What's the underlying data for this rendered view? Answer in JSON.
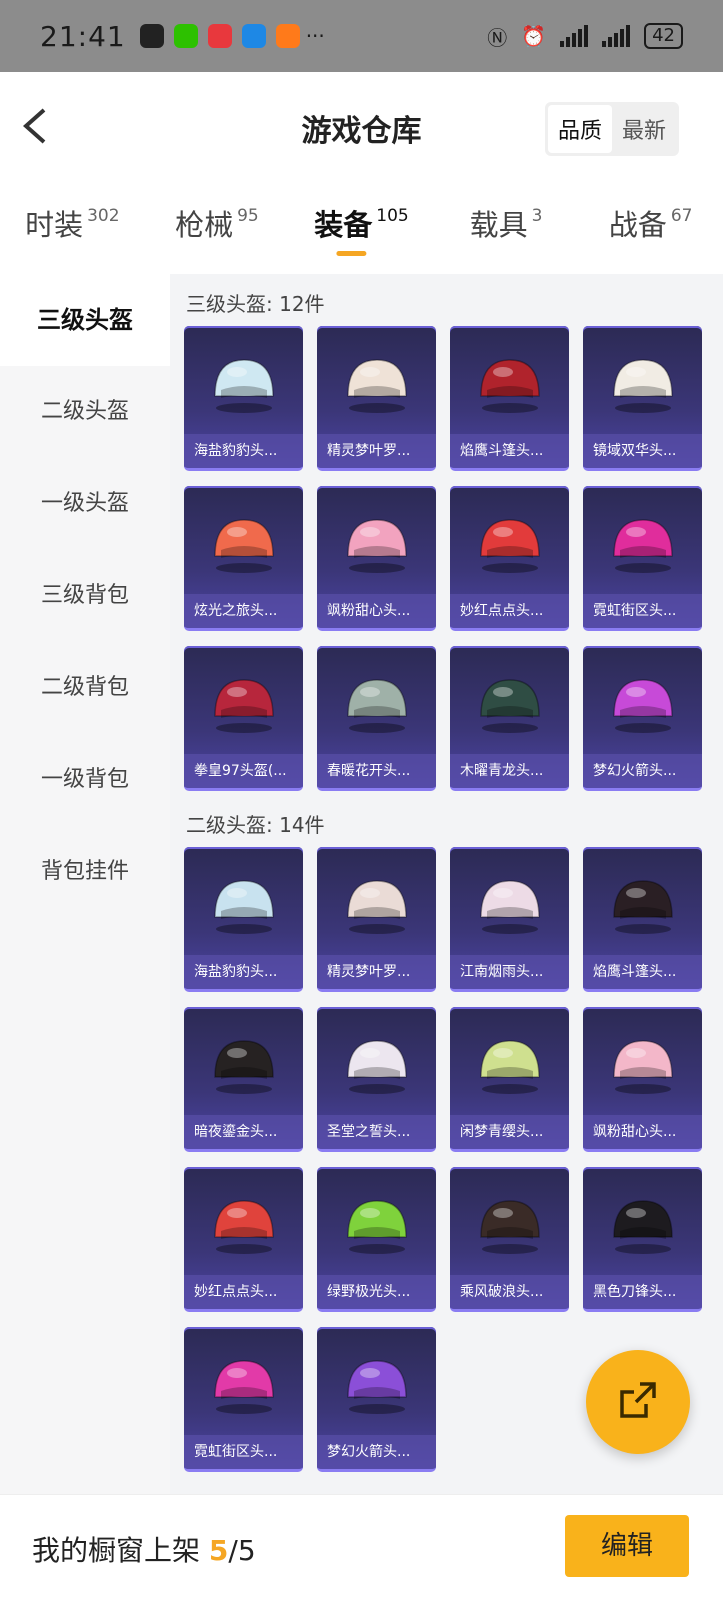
{
  "status_bar": {
    "time": "21:41",
    "battery": "42",
    "notification_icons": [
      {
        "name": "qq-icon",
        "color": "#222222"
      },
      {
        "name": "wechat-icon",
        "color": "#2dc100"
      },
      {
        "name": "app-red-icon",
        "color": "#e8383d"
      },
      {
        "name": "message-icon",
        "color": "#1e88e5"
      },
      {
        "name": "app-orange-icon",
        "color": "#ff7a1a"
      }
    ],
    "more": "···"
  },
  "header": {
    "back_icon": "chevron-left-icon",
    "title": "游戏仓库",
    "sort_options": [
      "品质",
      "最新"
    ],
    "active_sort": "品质"
  },
  "categories": [
    {
      "label": "时装",
      "count": "302"
    },
    {
      "label": "枪械",
      "count": "95"
    },
    {
      "label": "装备",
      "count": "105",
      "active": true
    },
    {
      "label": "载具",
      "count": "3"
    },
    {
      "label": "战备",
      "count": "67"
    }
  ],
  "sidebar": {
    "items": [
      {
        "label": "三级头盔",
        "active": true
      },
      {
        "label": "二级头盔"
      },
      {
        "label": "一级头盔"
      },
      {
        "label": "三级背包"
      },
      {
        "label": "二级背包"
      },
      {
        "label": "一级背包"
      },
      {
        "label": "背包挂件"
      }
    ]
  },
  "sections": [
    {
      "title": "三级头盔: 12件",
      "items": [
        {
          "name": "海盐豹豹头...",
          "color": "#cfe8f2"
        },
        {
          "name": "精灵梦叶罗...",
          "color": "#efe2d7"
        },
        {
          "name": "焰鹰斗篷头...",
          "color": "#b0232c"
        },
        {
          "name": "镜域双华头...",
          "color": "#f1ece4"
        },
        {
          "name": "炫光之旅头...",
          "color": "#f06a4c"
        },
        {
          "name": "飒粉甜心头...",
          "color": "#f2a3bf"
        },
        {
          "name": "妙红点点头...",
          "color": "#e23b3b"
        },
        {
          "name": "霓虹街区头...",
          "color": "#e02d9c"
        },
        {
          "name": "拳皇97头盔(...",
          "color": "#b7263c"
        },
        {
          "name": "春暖花开头...",
          "color": "#9fb1a8"
        },
        {
          "name": "木曜青龙头...",
          "color": "#2f4d44"
        },
        {
          "name": "梦幻火箭头...",
          "color": "#c74ad8"
        }
      ]
    },
    {
      "title": "二级头盔: 14件",
      "items": [
        {
          "name": "海盐豹豹头...",
          "color": "#c8e2ef"
        },
        {
          "name": "精灵梦叶罗...",
          "color": "#eadbd6"
        },
        {
          "name": "江南烟雨头...",
          "color": "#eddbe6"
        },
        {
          "name": "焰鹰斗篷头...",
          "color": "#2a1f24"
        },
        {
          "name": "暗夜鎏金头...",
          "color": "#262222"
        },
        {
          "name": "圣堂之誓头...",
          "color": "#ece6ef"
        },
        {
          "name": "闲梦青缨头...",
          "color": "#cfe08f"
        },
        {
          "name": "飒粉甜心头...",
          "color": "#f3b7c9"
        },
        {
          "name": "妙红点点头...",
          "color": "#e0433c"
        },
        {
          "name": "绿野极光头...",
          "color": "#7fd23c"
        },
        {
          "name": "乘风破浪头...",
          "color": "#3a2b27"
        },
        {
          "name": "黑色刀锋头...",
          "color": "#1d1b1f"
        },
        {
          "name": "霓虹街区头...",
          "color": "#e23aa8"
        },
        {
          "name": "梦幻火箭头...",
          "color": "#8b4fd8"
        }
      ]
    }
  ],
  "fab": {
    "icon": "open-external-icon"
  },
  "bottom_bar": {
    "label": "我的橱窗上架",
    "current": "5",
    "separator": "/",
    "total": "5",
    "edit_label": "编辑"
  },
  "colors": {
    "accent": "#f9b21b",
    "card_bg": "#3b3678"
  }
}
